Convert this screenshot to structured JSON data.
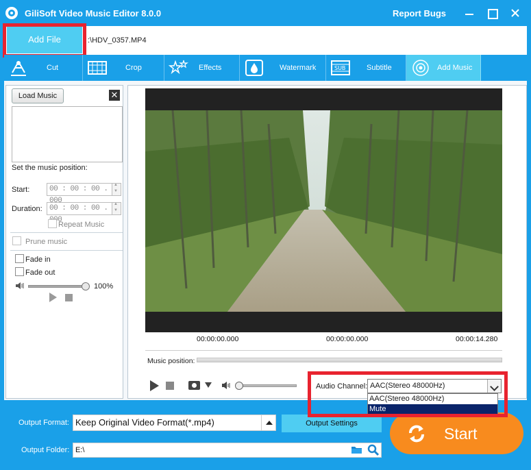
{
  "window": {
    "title": "GiliSoft Video Music Editor 8.0.0",
    "report_bugs": "Report Bugs"
  },
  "filebar": {
    "add_file": "Add File",
    "file_path": ":\\HDV_0357.MP4"
  },
  "tabs": [
    {
      "label": "Cut",
      "icon": "cut-icon"
    },
    {
      "label": "Crop",
      "icon": "crop-icon"
    },
    {
      "label": "Effects",
      "icon": "effects-icon"
    },
    {
      "label": "Watermark",
      "icon": "watermark-icon"
    },
    {
      "label": "Subtitle",
      "icon": "subtitle-icon"
    },
    {
      "label": "Add Music",
      "icon": "music-icon",
      "active": true
    }
  ],
  "music_panel": {
    "load_music": "Load Music",
    "close": "✕",
    "position_heading": "Set the music position:",
    "start_label": "Start:",
    "start_value": "00 : 00 : 00 . 000",
    "duration_label": "Duration:",
    "duration_value": "00 : 00 : 00 . 000",
    "repeat_music": "Repeat Music",
    "prune_music": "Prune music",
    "fade_in": "Fade in",
    "fade_out": "Fade out",
    "volume_percent": "100%",
    "volume_level": 1.0
  },
  "preview": {
    "time_start": "00:00:00.000",
    "time_current": "00:00:00.000",
    "time_end": "00:00:14.280",
    "music_position_label": "Music position:",
    "audio_channel_label": "Audio Channel:",
    "audio_channel_value": "AAC(Stereo 48000Hz)",
    "audio_channel_options": [
      "AAC(Stereo 48000Hz)",
      "Mute"
    ],
    "audio_channel_highlighted": "Mute"
  },
  "output": {
    "format_label": "Output Format:",
    "format_value": "Keep Original Video Format(*.mp4)",
    "settings_button": "Output Settings",
    "folder_label": "Output Folder:",
    "folder_value": "E:\\",
    "start_button": "Start"
  },
  "colors": {
    "brand_blue": "#1aa0e8",
    "accent_cyan": "#4fcdf2",
    "start_orange": "#f88b1e",
    "highlight_red": "#e8232f",
    "selection_navy": "#0a246a"
  }
}
